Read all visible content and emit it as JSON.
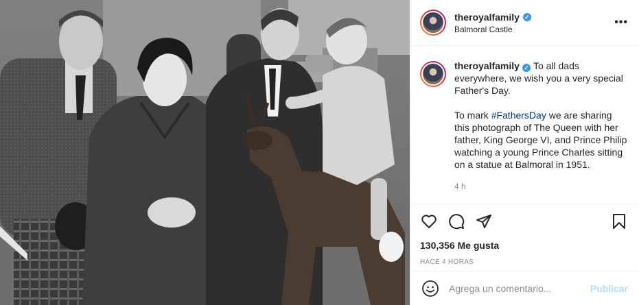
{
  "post": {
    "photo_alt": "Photograph",
    "photo_description": ""
  },
  "header": {
    "username": "theroyalfamily",
    "verified": "✓",
    "location": "Balmoral Castle",
    "more": "•••"
  },
  "caption": {
    "username": "theroyalfamily",
    "verified": "✓",
    "line1": "To all dads everywhere, we wish you a very special Father's Day.",
    "p2_before": "To mark ",
    "hashtag": "#FathersDay",
    "p2_after": " we are sharing this photograph of The Queen with her father, King George VI, and Prince Philip watching a young Prince Charles sitting on a statue at Balmoral in 1951.",
    "time": "4 h"
  },
  "actions": {
    "icons": [
      "heart-icon",
      "comment-icon",
      "share-icon",
      "bookmark-icon"
    ],
    "likes": "130,356 Me gusta",
    "ago": "HACE 4 HORAS"
  },
  "comment": {
    "placeholder": "Agrega un comentario...",
    "publish": "Publicar"
  },
  "colors": {
    "link": "#00376b",
    "publish_disabled": "#b2dffc",
    "verified": "#3897f0",
    "muted": "#8e8e8e"
  }
}
